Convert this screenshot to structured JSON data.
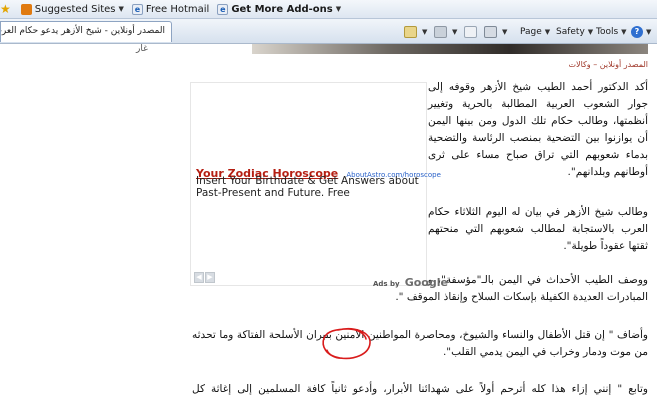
{
  "favorites_bar": {
    "suggested_sites": "Suggested Sites",
    "free_hotmail": "Free Hotmail",
    "get_more_addons": "Get More Add-ons"
  },
  "tab": {
    "title": "المصدر أونلاين - شيخ الأزهر يدعو حكام العرب..."
  },
  "command_bar": {
    "page": "Page",
    "safety": "Safety",
    "tools": "Tools"
  },
  "left_edge": {
    "text": "غار"
  },
  "article": {
    "source": "المصدر أونلاين – وكالات",
    "paragraphs": [
      "أكد الدكتور أحمد الطيب شيخ الأزهر وقوفه إلى جوار الشعوب العربية المطالبة بالحرية وتغيير أنظمتها، وطالب حكام تلك الدول ومن بينها اليمن أن يوازنوا بين التضحية بمنصب الرئاسة والتضحية بدماء شعوبهم التي تراق صباح مساء على ثرى أوطانهم وبلدانهم\".",
      "وطالب شيخ الأزهر في بيان له اليوم الثلاثاء حكام العرب بالاستجابة لمطالب شعوبهم التي منحتهم ثقتها عقوداً طويلة\".",
      "ووصف الطيب الأحداث في اليمن بالـ\"مؤسفة\"، وقال \" إن الدماء تنزف على مدار الساعة، وذلك رغم المبادرات العديدة الكفيلة بإسكات السلاح وإنقاذ الموقف \".",
      "وأضاف \" إن قتل الأطفال والنساء والشيوخ، ومحاصرة المواطنين الآمنين بنيران الأسلحة الفتاكة وما تحدثه من موت ودمار وخراب في اليمن يدمي القلب\".",
      "وتابع \" إنني إزاء هذا كله أترحم أولاً على شهدائنا الأبرار، وأدعو ثانياً كافة المسلمين إلى إغاثة كل المحتاجين"
    ]
  },
  "ad": {
    "title": "Your Zodiac Horoscope",
    "url": "AboutAstro.com/horoscope",
    "text": "Insert Your Birthdate & Get Answers about Past-Present and Future. Free",
    "ads_by": "Ads by",
    "google": "Google"
  },
  "colors": {
    "ad_title": "#b51e12",
    "source_text": "#a0382a",
    "annotation_circle": "#d91c1c"
  }
}
